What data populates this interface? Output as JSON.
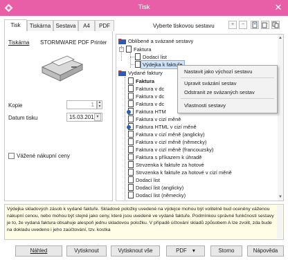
{
  "window": {
    "title": "Tisk",
    "close_glyph": "✕",
    "app_icon": "tisk-app-icon"
  },
  "tabs": [
    "Tisk",
    "Tiskárna",
    "Sestava",
    "A4",
    "PDF"
  ],
  "hint": "Vyberte tiskovou sestavu",
  "toolbar_icons": [
    "expand-all-icon",
    "collapse-all-icon",
    "info-icon",
    "favorites-icon",
    "copy-icon"
  ],
  "printer": {
    "label": "Tiskárna",
    "name": "STORMWARE PDF Printer",
    "image": "printer-icon"
  },
  "copies": {
    "label": "Kopie",
    "value": "1"
  },
  "date": {
    "label": "Datum tisku",
    "value": "15.03.2016"
  },
  "weighted": {
    "label": "Vážené nákupní ceny",
    "checked": false
  },
  "tree": {
    "favorites": "Oblíbené a svázané sestavy",
    "faktura": "Faktura",
    "dodaci_list": "Dodací list",
    "vydejka": "Výdejka k faktuře",
    "vydane": "Vydané faktury",
    "items": [
      "Faktura",
      "Faktura v dc",
      "Faktura v dc",
      "Faktura v dc",
      "Faktura HTM",
      "Faktura v cizí měně",
      "Faktura HTML v cizí měně",
      "Faktura v cizí měně (anglicky)",
      "Faktura v cizí měně (německy)",
      "Faktura v cizí měně (francouzsky)",
      "Faktura s příkazem k úhradě",
      "Strvzenka k faktuře za hotové",
      "Strvzenka k faktuře za hotové v cizí měně",
      "Dodací list",
      "Dodací list (anglicky)",
      "Dodací list (německy)"
    ]
  },
  "context_menu": [
    "Nastavit jako výchozí sestavu",
    "Upravit svázání sestav",
    "Odstranit ze svázaných sestav",
    "Vlastnosti sestavy"
  ],
  "description": "Výdejka skladových zásob k vydané faktuře. Skladové položky uvedené na výdejce mohou být volitelně bud oceněny váženou nákupní cenou, nebo mohou být stejné jako ceny, které jsou uvedené ve vydané faktuře. Podmínkou správné funkčnosti sestavy je to, že vydaná faktura obsahuje alespoň jednu skladovou položku. V případě účtování skladů způsobem A lze zvolit, zda bude na dokladu uvedeno i jeho zaúčtování, tzv. kostka",
  "buttons": {
    "nahled": "Náhled",
    "vytisknout": "Vytisknout",
    "vytisknout_vse": "Vytisknout vše",
    "pdf": "PDF",
    "storno": "Storno",
    "napoveda": "Nápověda"
  },
  "colors": {
    "titlebar": "#e85fa7",
    "selection": "#cfe3f8",
    "description_bg": "#fffde6"
  }
}
